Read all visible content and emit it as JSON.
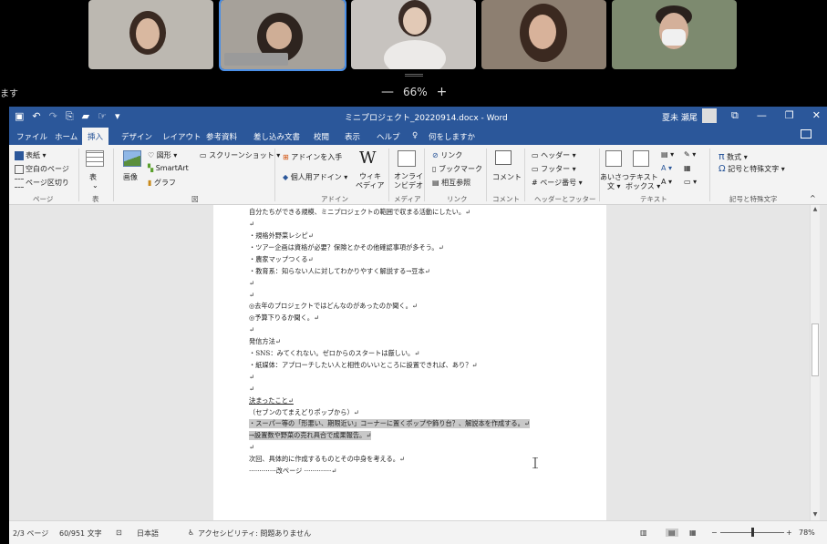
{
  "meeting": {
    "share_text": "ます",
    "zoom_minus": "—",
    "zoom_level": "66%",
    "zoom_plus": "+",
    "participants": [
      {
        "bg": "#bcb8b1"
      },
      {
        "bg": "#a6a19a"
      },
      {
        "bg": "#c7c3bf"
      },
      {
        "bg": "#8d7f71"
      },
      {
        "bg": "#7d8a6f"
      }
    ]
  },
  "word": {
    "title": "ミニプロジェクト_20220914.docx - Word",
    "user": "夏未 瀬尾",
    "tabs": [
      "ファイル",
      "ホーム",
      "挿入",
      "デザイン",
      "レイアウト",
      "参考資料",
      "差し込み文書",
      "校閲",
      "表示",
      "ヘルプ"
    ],
    "tell_me": "何をしますか",
    "ribbon": {
      "pages": {
        "cover": "表紙",
        "blank": "空白のページ",
        "break": "ページ区切り",
        "group": "ページ"
      },
      "table": {
        "label": "表",
        "group": "表"
      },
      "illustrations": {
        "picture": "画像",
        "shapes": "図形",
        "smartart": "SmartArt",
        "chart": "グラフ",
        "screenshot": "スクリーンショット",
        "group": "図"
      },
      "addins": {
        "get": "アドインを入手",
        "my": "個人用アドイン",
        "wiki_letter": "W",
        "wiki_line1": "ウィキ",
        "wiki_line2": "ペディア",
        "group": "アドイン"
      },
      "media": {
        "line1": "オンライ",
        "line2": "ンビデオ",
        "group": "メディア"
      },
      "links": {
        "link": "リンク",
        "bookmark": "ブックマーク",
        "xref": "相互参照",
        "group": "リンク"
      },
      "comments": {
        "label": "コメント",
        "group": "コメント"
      },
      "hf": {
        "header": "ヘッダー",
        "footer": "フッター",
        "pagenum": "ページ番号",
        "group": "ヘッダーとフッター"
      },
      "text": {
        "greet_line1": "あいさつ",
        "greet_line2": "文",
        "textbox_line1": "テキスト",
        "textbox_line2": "ボックス",
        "group": "テキスト"
      },
      "symbols": {
        "equation": "数式",
        "symbol": "記号と特殊文字",
        "group": "記号と特殊文字"
      }
    },
    "document_lines": [
      {
        "text": "自分たちができる規模、ミニプロジェクトの範囲で収まる活動にしたい。↵",
        "hl": false,
        "u": false
      },
      {
        "text": "↵",
        "hl": false,
        "u": false
      },
      {
        "text": "・規格外野菜レシピ↵",
        "hl": false,
        "u": false
      },
      {
        "text": "・ツアー企画は資格が必要？保険とかその他確認事項が多そう。↵",
        "hl": false,
        "u": false
      },
      {
        "text": "・農家マップつくる↵",
        "hl": false,
        "u": false
      },
      {
        "text": "・教育系：知らない人に対してわかりやすく解説する→豆本↵",
        "hl": false,
        "u": false
      },
      {
        "text": "↵",
        "hl": false,
        "u": false
      },
      {
        "text": "↵",
        "hl": false,
        "u": false
      },
      {
        "text": "◎去年のプロジェクトではどんなのがあったのか聞く。↵",
        "hl": false,
        "u": false
      },
      {
        "text": "◎予算下りるか聞く。↵",
        "hl": false,
        "u": false
      },
      {
        "text": "↵",
        "hl": false,
        "u": false
      },
      {
        "text": "発信方法↵",
        "hl": false,
        "u": false
      },
      {
        "text": "・SNS：みてくれない。ゼロからのスタートは厳しい。↵",
        "hl": false,
        "u": false
      },
      {
        "text": "・紙媒体：アプローチしたい人と相性のいいところに設置できれば、あり？↵",
        "hl": false,
        "u": false
      },
      {
        "text": "↵",
        "hl": false,
        "u": false
      },
      {
        "text": "↵",
        "hl": false,
        "u": false
      },
      {
        "text": "決まったこと↵",
        "hl": false,
        "u": true
      },
      {
        "text": "（セブンのてまえどりポップから）↵",
        "hl": false,
        "u": false
      },
      {
        "text": "・スーパー等の「形悪い、期限近い」コーナーに置くポップや飾り台？、解説本を作成する。↵",
        "hl": true,
        "u": false
      },
      {
        "text": "→設置数や野菜の売れ具合で成果報告。↵",
        "hl": true,
        "u": false
      },
      {
        "text": "↵",
        "hl": false,
        "u": false
      },
      {
        "text": "次回、具体的に作成するものとその中身を考える。↵",
        "hl": false,
        "u": false
      },
      {
        "text": "·············改ページ ·············↵",
        "hl": false,
        "u": false
      }
    ],
    "status": {
      "page": "2/3 ページ",
      "words": "60/951 文字",
      "lang": "日本語",
      "a11y": "アクセシビリティ: 問題ありません",
      "zoom_minus": "−",
      "zoom_plus": "+",
      "zoom_level": "78%",
      "zoom_fraction": 0.78
    },
    "colors": {
      "brand": "#2b579a",
      "highlight": "#c8c8c8"
    }
  }
}
